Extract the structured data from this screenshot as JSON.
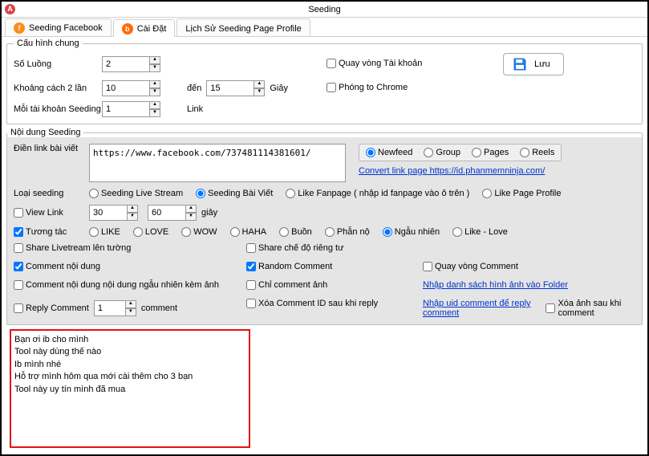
{
  "window": {
    "title": "Seeding"
  },
  "tabs": {
    "t0": "Seeding Facebook",
    "t1": "Cài Đặt",
    "t2": "Lịch Sử Seeding Page Profile"
  },
  "config": {
    "legend": "Cấu hình chung",
    "so_luong_label": "Số Luồng",
    "so_luong": "2",
    "khoangcach_label": "Khoảng cách 2 lần",
    "khoangcach_from": "10",
    "den": "đến",
    "khoangcach_to": "15",
    "giay": "Giây",
    "moitaikhoan_label": "Mỗi tài khoản Seeding",
    "moitaikhoan": "1",
    "link_text": "Link",
    "quayvong": "Quay vòng Tài khoản",
    "phongto": "Phóng to Chrome",
    "save": "Lưu"
  },
  "seed": {
    "legend": "Nội dung Seeding",
    "dienlink_label": "Điền link bài viết",
    "link_value": "https://www.facebook.com/737481114381601/",
    "src_newfeed": "Newfeed",
    "src_group": "Group",
    "src_pages": "Pages",
    "src_reels": "Reels",
    "convert_link": "Convert link page https://id.phanmemninja.com/",
    "loaiseeding_label": "Loại seeding",
    "ls_live": "Seeding Live Stream",
    "ls_baiviet": "Seeding Bài Viết",
    "ls_fanpage": "Like Fanpage ( nhập id fanpage vào ô trên )",
    "ls_profile": "Like Page Profile",
    "viewlink_label": "View Link",
    "viewlink_from": "30",
    "viewlink_to": "60",
    "viewlink_giay": "giây",
    "tuongtac_label": "Tương tác",
    "r_like": "LIKE",
    "r_love": "LOVE",
    "r_wow": "WOW",
    "r_haha": "HAHA",
    "r_buon": "Buồn",
    "r_phanno": "Phẫn nộ",
    "r_ngaunhien": "Ngẫu nhiên",
    "r_likelove": "Like - Love",
    "share_live": "Share Livetream lên tường",
    "share_private": "Share chế độ riêng tư",
    "comment_noidung": "Comment nội dung",
    "random_comment": "Random Comment",
    "quayvong_comment": "Quay vòng Comment",
    "comment_ngaunhien": "Comment nội dung nội dung ngẫu nhiên kèm ảnh",
    "chicomment_anh": "Chỉ comment ảnh",
    "nhap_ds_anh": "Nhập danh sách hình ảnh vào Folder",
    "reply_comment": "Reply Comment",
    "reply_val": "1",
    "reply_unit": "comment",
    "xoa_comment_id": "Xóa Comment ID sau khi reply",
    "nhap_uid": "Nhập uid comment để reply comment",
    "xoa_anh": "Xóa ảnh sau khi comment"
  },
  "comments_text": "Bạn ơi ib cho mình\nTool này dùng thế nào\nIb mình nhé\nHỗ trợ mình hôm qua mới cài thêm cho 3 bạn\nTool này uy tín mình đã mua"
}
